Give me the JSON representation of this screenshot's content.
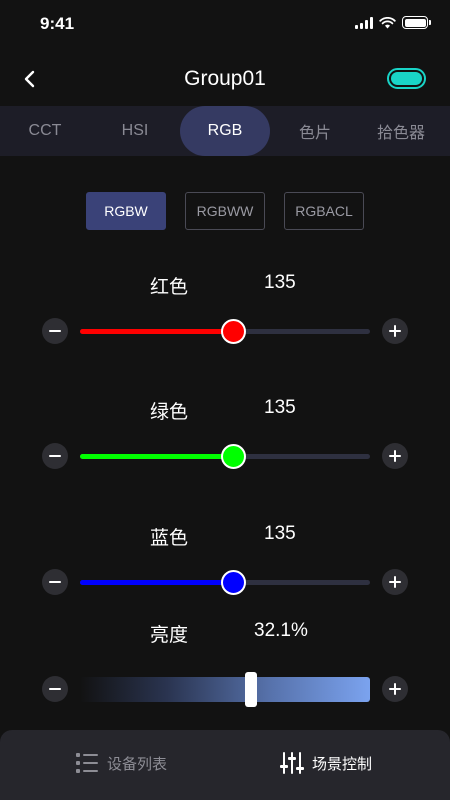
{
  "status_bar": {
    "time": "9:41",
    "icons": [
      "signal-icon",
      "wifi-icon",
      "battery-icon"
    ]
  },
  "header": {
    "back_icon": "chevron-left-icon",
    "title": "Group01",
    "power_toggle": {
      "on": true,
      "color": "#19d4c7"
    }
  },
  "tabs": [
    {
      "label": "CCT",
      "active": false
    },
    {
      "label": "HSI",
      "active": false
    },
    {
      "label": "RGB",
      "active": true
    },
    {
      "label": "色片",
      "active": false
    },
    {
      "label": "拾色器",
      "active": false
    }
  ],
  "modes": [
    {
      "label": "RGBW",
      "active": true
    },
    {
      "label": "RGBWW",
      "active": false
    },
    {
      "label": "RGBACL",
      "active": false
    }
  ],
  "channels": [
    {
      "label": "红色",
      "value": "135",
      "level": 135,
      "max": 255,
      "color": "#ff0000"
    },
    {
      "label": "绿色",
      "value": "135",
      "level": 135,
      "max": 255,
      "color": "#00ff00"
    },
    {
      "label": "蓝色",
      "value": "135",
      "level": 135,
      "max": 255,
      "color": "#0000ff"
    }
  ],
  "brightness": {
    "label": "亮度",
    "value": "32.1%",
    "level": 0.59
  },
  "bottom_nav": {
    "devices": {
      "label": "设备列表",
      "icon": "list-icon",
      "active": false
    },
    "scenes": {
      "label": "场景控制",
      "icon": "sliders-icon",
      "active": true
    }
  },
  "colors": {
    "background": "#121212",
    "tab_bar": "#1d1d27",
    "active_tab": "#353a62",
    "active_mode": "#3a4278",
    "accent": "#19d4c7"
  }
}
